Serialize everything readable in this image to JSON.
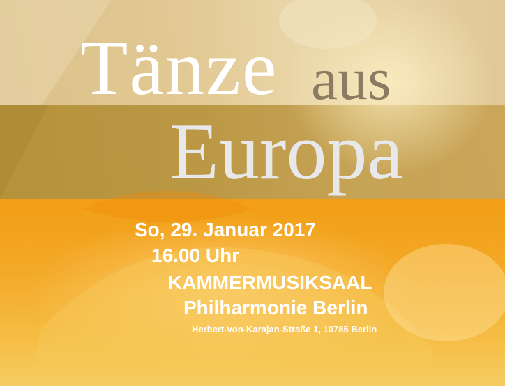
{
  "title": {
    "line1_word1": "Tänze",
    "line1_word2": "aus",
    "line2": "Europa"
  },
  "event": {
    "date": "So, 29. Januar 2017",
    "time": "16.00 Uhr",
    "venue": "KAMMERMUSIKSAAL",
    "hall": "Philharmonie Berlin",
    "address": "Herbert-von-Karajan-Straße 1, 10785 Berlin"
  },
  "colors": {
    "title_white": "#ffffff",
    "title_grey": "#8a7b62",
    "title_silver": "#e8e8ea",
    "band_gold": "#b38f3a",
    "band_orange": "#f29a10"
  }
}
